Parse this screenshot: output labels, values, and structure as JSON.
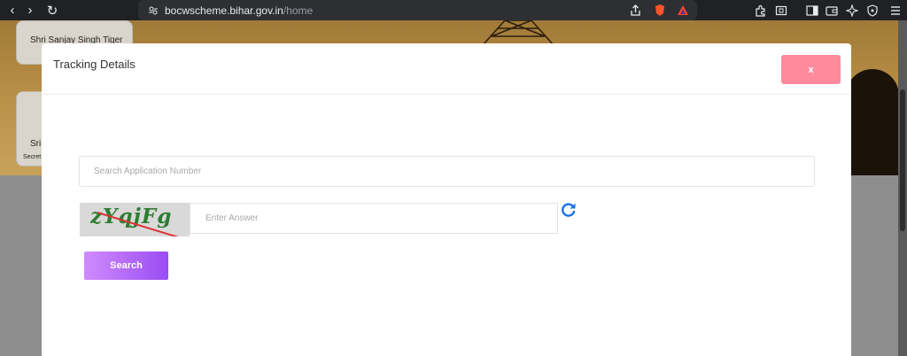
{
  "browser": {
    "url_host": "bocwscheme.bihar.gov.in",
    "url_path": "/home"
  },
  "background": {
    "card1_text": "Shri Sanjay Singh Tiger",
    "card2_text": "Sri.",
    "card2_subtext": "Secret"
  },
  "modal": {
    "title": "Tracking Details",
    "close_label": "x",
    "application_placeholder": "Search Application Number",
    "captcha_text": "zYqjFg",
    "answer_placeholder": "Enter Answer",
    "search_label": "Search"
  },
  "colors": {
    "close_button": "#ff8a9c",
    "search_gradient_start": "#d08bff",
    "search_gradient_end": "#9a4cf2",
    "refresh_icon": "#1a73e8"
  },
  "icons": [
    "back-icon",
    "forward-icon",
    "reload-icon",
    "bookmark-icon",
    "site-settings-icon",
    "share-icon",
    "brave-shields-icon",
    "brave-rewards-icon",
    "extensions-icon",
    "screenshot-icon",
    "sidebar-icon",
    "wallet-icon",
    "leo-icon",
    "vpn-icon",
    "menu-icon",
    "refresh-captcha-icon"
  ]
}
